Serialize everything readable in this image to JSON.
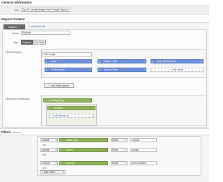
{
  "general": {
    "heading": "General Information",
    "title_label": "Title",
    "title_value": "Top 10 Landing Pages from Google Organic"
  },
  "report_content": {
    "heading": "Report Content",
    "tab_label": "Explorer",
    "add_report_tab": "+ add report tab",
    "name_label": "Name",
    "name_value": "Explorer",
    "type_label": "Type",
    "type_options": [
      "Explorer",
      "Flat Table"
    ],
    "metric_groups_label": "Metric Groups",
    "metric_group_name": "Site Usage",
    "metrics": [
      "Visits",
      "Pages / Visit",
      "Avg. Visit Duration",
      "% New Visits",
      "Bounce Rate"
    ],
    "add_metric": "+ add metric",
    "add_metric_group": "+ Add metric group",
    "dimension_drilldowns_label": "Dimension Drilldowns",
    "dimensions": [
      "Landing Page",
      "Keyword"
    ],
    "add_dimension": "+ add dimension"
  },
  "filters": {
    "heading": "Filters",
    "optional": "- optional",
    "rows": [
      {
        "mode": "Include",
        "dimension": "Traffic Type",
        "match": "Exact",
        "value": "organic"
      },
      {
        "mode": "Include",
        "dimension": "Source",
        "match": "Exact",
        "value": "google"
      },
      {
        "mode": "Exclude",
        "dimension": "Keyword",
        "match": "Exact",
        "value": "(not provided)"
      }
    ],
    "and_label": "and",
    "add_filter": "+ Add a filter"
  },
  "colors": {
    "metric_pill": "#6d8fd6",
    "dimension_pill": "#8fb05a",
    "link": "#2a5db0"
  }
}
